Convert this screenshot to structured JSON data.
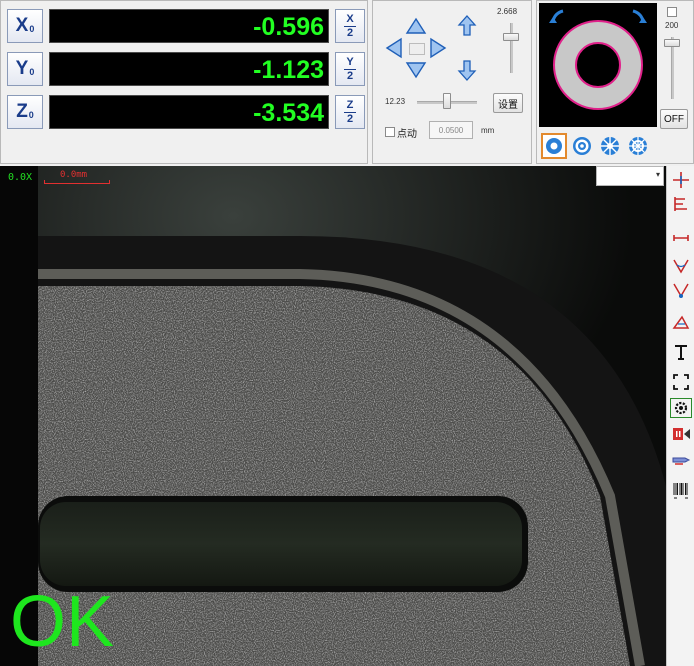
{
  "dro": {
    "axes": [
      {
        "label": "X",
        "sub": "0",
        "value": "-0.596",
        "half_top": "X",
        "half_bottom": "2"
      },
      {
        "label": "Y",
        "sub": "0",
        "value": "-1.123",
        "half_top": "Y",
        "half_bottom": "2"
      },
      {
        "label": "Z",
        "sub": "0",
        "value": "-3.534",
        "half_top": "Z",
        "half_bottom": "2"
      }
    ]
  },
  "jog": {
    "zoom_value": "2.668",
    "speed_value": "12.23",
    "set_button": "设置",
    "inching_label": "点动",
    "step_value": "0.0500",
    "step_unit": "mm"
  },
  "light": {
    "intensity_value": "200",
    "off_button": "OFF",
    "modes": [
      "ring-light-icon",
      "coaxial-light-icon",
      "sector-light-icon",
      "segment-ring-icon"
    ],
    "ring_color": "#e0218a",
    "arrow_color": "#2a7fd6"
  },
  "camera": {
    "magnification": "0.0X",
    "scale_label": "0.0mm",
    "result": "OK",
    "result_color": "#1ee61e",
    "dropdown_value": ""
  },
  "tools": [
    "crosshair-icon",
    "edge-tool-icon",
    "distance-icon",
    "angle-icon",
    "angle-vertex-icon",
    "area-icon",
    "text-icon",
    "fullscreen-icon",
    "settings-icon",
    "record-icon",
    "probe-icon",
    "barcode-icon"
  ]
}
